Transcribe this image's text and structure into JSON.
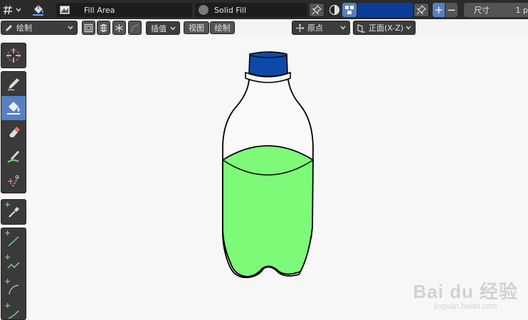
{
  "topbar": {
    "brush_name": "Fill Area",
    "material_name": "Solid Fill",
    "size_label": "尺寸",
    "size_value": "1 p",
    "color_swatch": "#0a3d9c",
    "plus_label": "+",
    "minus_label": "−"
  },
  "toolbar": {
    "mode_label": "绘制",
    "interp_label": "插值",
    "view_label": "视图",
    "draw_label": "绘制",
    "origin_label": "原点",
    "plane_label": "正面(X-Z)"
  },
  "tools": [
    {
      "icon": "cursor-icon"
    },
    {
      "icon": "draw-pencil-icon"
    },
    {
      "icon": "fill-bucket-icon",
      "active": true
    },
    {
      "icon": "eraser-icon"
    },
    {
      "icon": "tint-icon"
    },
    {
      "icon": "cutter-icon"
    },
    {
      "icon": "eyedropper-icon"
    },
    {
      "icon": "line-icon"
    },
    {
      "icon": "polyline-icon"
    },
    {
      "icon": "arc-icon"
    },
    {
      "icon": "curve-icon"
    }
  ],
  "canvas": {
    "cap_color": "#0d4aa8",
    "liquid_color": "#7dfa78",
    "bottle_color": "#f9f9f9"
  },
  "watermark": {
    "brand": "Bai du 经验",
    "url": "jingyan.baidu.com"
  }
}
